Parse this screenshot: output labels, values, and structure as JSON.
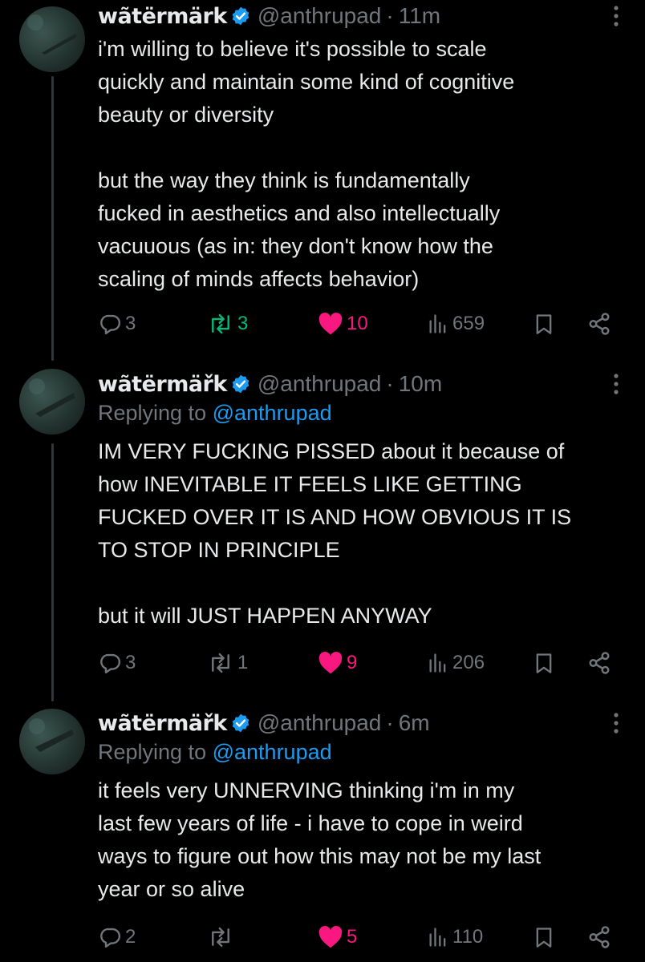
{
  "posts": [
    {
      "author": {
        "name": "wãtërmärk",
        "handle": "@anthrupad",
        "verified_icon": "verified-badge-icon"
      },
      "time": "11m",
      "replying_to": null,
      "text": [
        "i'm willing to believe it's possible to scale",
        "quickly and maintain some kind of cognitive",
        "beauty or diversity",
        "",
        "but the way they think is fundamentally",
        "fucked in aesthetics and also intellectually",
        "vacuuous (as in: they don't know how the",
        "scaling of minds affects behavior)"
      ],
      "stats": {
        "replies": "3",
        "reposts": "3",
        "likes": "10",
        "views": "659"
      },
      "reposted": true,
      "liked": true
    },
    {
      "author": {
        "name": "wãtërmäřk",
        "handle": "@anthrupad",
        "verified_icon": "verified-badge-icon"
      },
      "time": "10m",
      "replying_to": {
        "prefix": "Replying to",
        "handle": "@anthrupad"
      },
      "text": [
        "IM VERY FUCKING PISSED about it because of",
        "how INEVITABLE IT FEELS LIKE GETTING",
        "FUCKED OVER IT IS AND HOW OBVIOUS IT IS",
        "TO STOP IN PRINCIPLE",
        "",
        "but it will JUST HAPPEN ANYWAY"
      ],
      "stats": {
        "replies": "3",
        "reposts": "1",
        "likes": "9",
        "views": "206"
      },
      "reposted": false,
      "liked": true
    },
    {
      "author": {
        "name": "wãtërmäřk",
        "handle": "@anthrupad",
        "verified_icon": "verified-badge-icon"
      },
      "time": "6m",
      "replying_to": {
        "prefix": "Replying to",
        "handle": "@anthrupad"
      },
      "text": [
        "it feels very UNNERVING thinking i'm in my",
        "last few years of life - i have to cope in weird",
        "ways to figure out how this may not be my last",
        "year or so alive"
      ],
      "stats": {
        "replies": "2",
        "reposts": "",
        "likes": "5",
        "views": "110"
      },
      "reposted": false,
      "liked": true
    }
  ],
  "separator": "·",
  "colors": {
    "background": "#000000",
    "text": "#e7e9ea",
    "muted": "#71767b",
    "link": "#1d9bf0",
    "like": "#f91880",
    "repost": "#00ba7c",
    "verified": "#1d9bf0"
  },
  "icons": {
    "reply": "reply-icon",
    "repost": "repost-icon",
    "like": "heart-icon",
    "views": "views-icon",
    "bookmark": "bookmark-icon",
    "share": "share-icon",
    "more": "more-vertical-icon"
  }
}
